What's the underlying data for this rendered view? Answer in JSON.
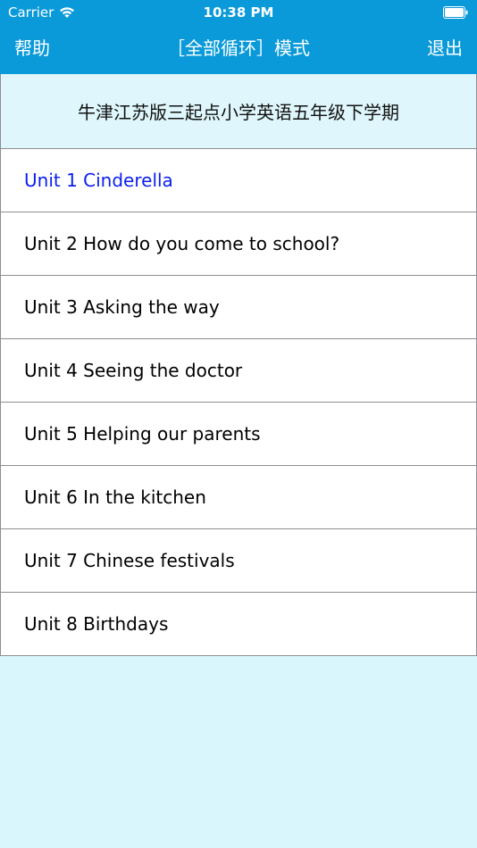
{
  "status_bar": {
    "carrier": "Carrier",
    "time": "10:38 PM",
    "wifi_icon": "wifi-icon",
    "battery_icon": "battery-icon"
  },
  "nav": {
    "left_label": "帮助",
    "title": "［全部循环］模式",
    "right_label": "退出"
  },
  "book_title": "牛津江苏版三起点小学英语五年级下学期",
  "units": [
    {
      "label": "Unit 1 Cinderella",
      "selected": true
    },
    {
      "label": "Unit 2 How do you come to school?",
      "selected": false
    },
    {
      "label": "Unit 3 Asking the way",
      "selected": false
    },
    {
      "label": "Unit 4 Seeing the doctor",
      "selected": false
    },
    {
      "label": "Unit 5 Helping our parents",
      "selected": false
    },
    {
      "label": "Unit 6 In the kitchen",
      "selected": false
    },
    {
      "label": "Unit 7 Chinese festivals",
      "selected": false
    },
    {
      "label": "Unit 8 Birthdays",
      "selected": false
    }
  ],
  "colors": {
    "nav_background": "#0a9ad9",
    "page_background": "#d9f6fd",
    "selected_text": "#0b1ff0"
  }
}
